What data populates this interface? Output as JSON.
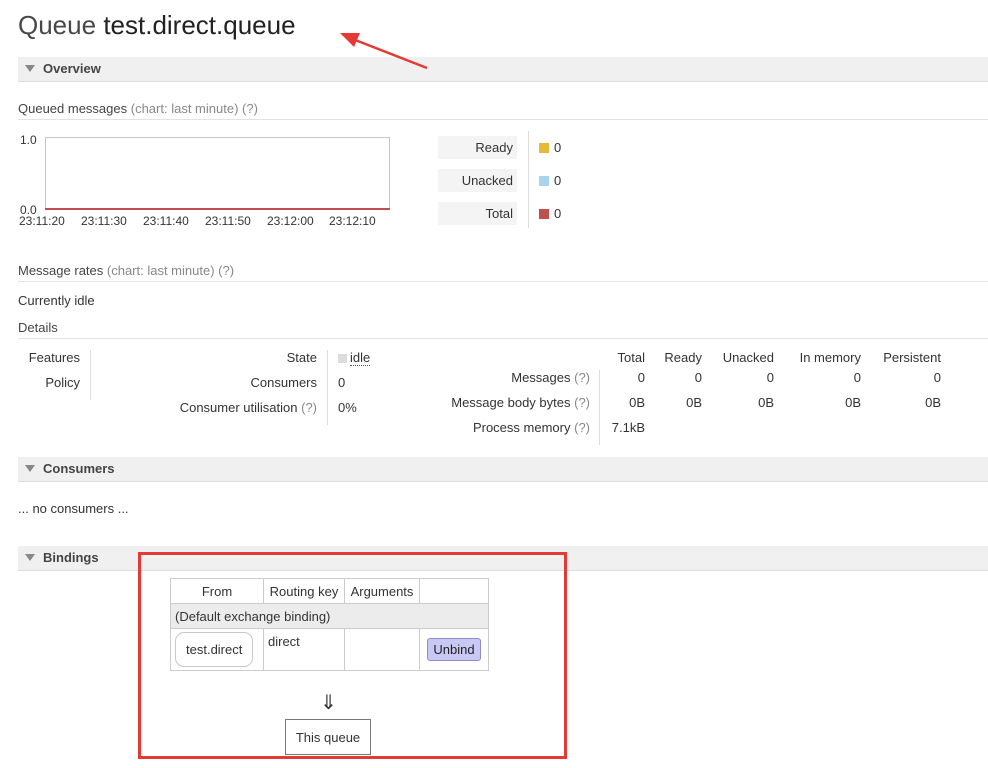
{
  "header": {
    "prefix": "Queue",
    "queue_name": "test.direct.queue"
  },
  "sections": {
    "overview": "Overview",
    "consumers": "Consumers",
    "bindings": "Bindings"
  },
  "queued_messages": {
    "title": "Queued messages",
    "chart_hint": "(chart: last minute)",
    "help": "(?)",
    "y_top": "1.0",
    "y_bottom": "0.0",
    "x_ticks": [
      "23:11:20",
      "23:11:30",
      "23:11:40",
      "23:11:50",
      "23:12:00",
      "23:12:10"
    ],
    "legend": [
      {
        "label": "Ready",
        "value": "0",
        "color": "#e8b83a"
      },
      {
        "label": "Unacked",
        "value": "0",
        "color": "#a8d4f0"
      },
      {
        "label": "Total",
        "value": "0",
        "color": "#c0504d"
      }
    ]
  },
  "message_rates": {
    "title": "Message rates",
    "chart_hint": "(chart: last minute)",
    "help": "(?)",
    "status": "Currently idle"
  },
  "details": {
    "title": "Details",
    "features_label": "Features",
    "policy_label": "Policy",
    "state_label": "State",
    "state_value": "idle",
    "consumers_label": "Consumers",
    "consumers_value": "0",
    "util_label": "Consumer utilisation",
    "util_help": "(?)",
    "util_value": "0%",
    "columns": [
      "Total",
      "Ready",
      "Unacked",
      "In memory",
      "Persistent"
    ],
    "rows": [
      {
        "label": "Messages",
        "help": "(?)",
        "values": [
          "0",
          "0",
          "0",
          "0",
          "0"
        ]
      },
      {
        "label": "Message body bytes",
        "help": "(?)",
        "values": [
          "0B",
          "0B",
          "0B",
          "0B",
          "0B"
        ]
      },
      {
        "label": "Process memory",
        "help": "(?)",
        "values": [
          "7.1kB"
        ]
      }
    ]
  },
  "consumers": {
    "empty": "... no consumers ..."
  },
  "bindings": {
    "headers": [
      "From",
      "Routing key",
      "Arguments"
    ],
    "default_binding": "(Default exchange binding)",
    "row": {
      "from": "test.direct",
      "routing_key": "direct",
      "arguments": "",
      "action": "Unbind"
    },
    "arrow": "⇓",
    "this_queue": "This queue"
  },
  "annotation_color": "#e53935"
}
